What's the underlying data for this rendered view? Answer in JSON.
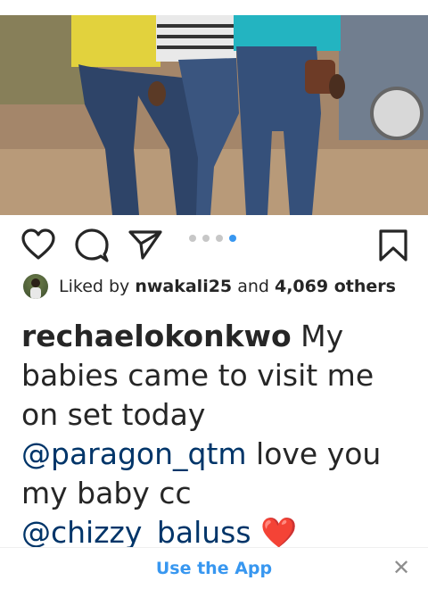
{
  "post": {
    "liked_by_prefix": "Liked by ",
    "liked_by_user": "nwakali25",
    "liked_by_and": " and ",
    "liked_by_count": "4,069 others",
    "caption": {
      "username": "rechaelokonkwo",
      "text_1": " My babies came to visit me on set today ",
      "mention_1": "@paragon_qtm",
      "text_2": " love you my baby cc ",
      "mention_2": "@chizzy_baluss",
      "emoji": "❤️"
    },
    "carousel": {
      "count": 4,
      "active_index": 3
    }
  },
  "banner": {
    "use_app_label": "Use the App",
    "close_label": "✕"
  },
  "icons": {
    "like": "heart-outline-icon",
    "comment": "comment-bubble-icon",
    "share": "paper-plane-icon",
    "save": "bookmark-outline-icon"
  },
  "colors": {
    "link": "#3897f0",
    "mention": "#003569",
    "text": "#262626",
    "heart": "#e0212a"
  }
}
